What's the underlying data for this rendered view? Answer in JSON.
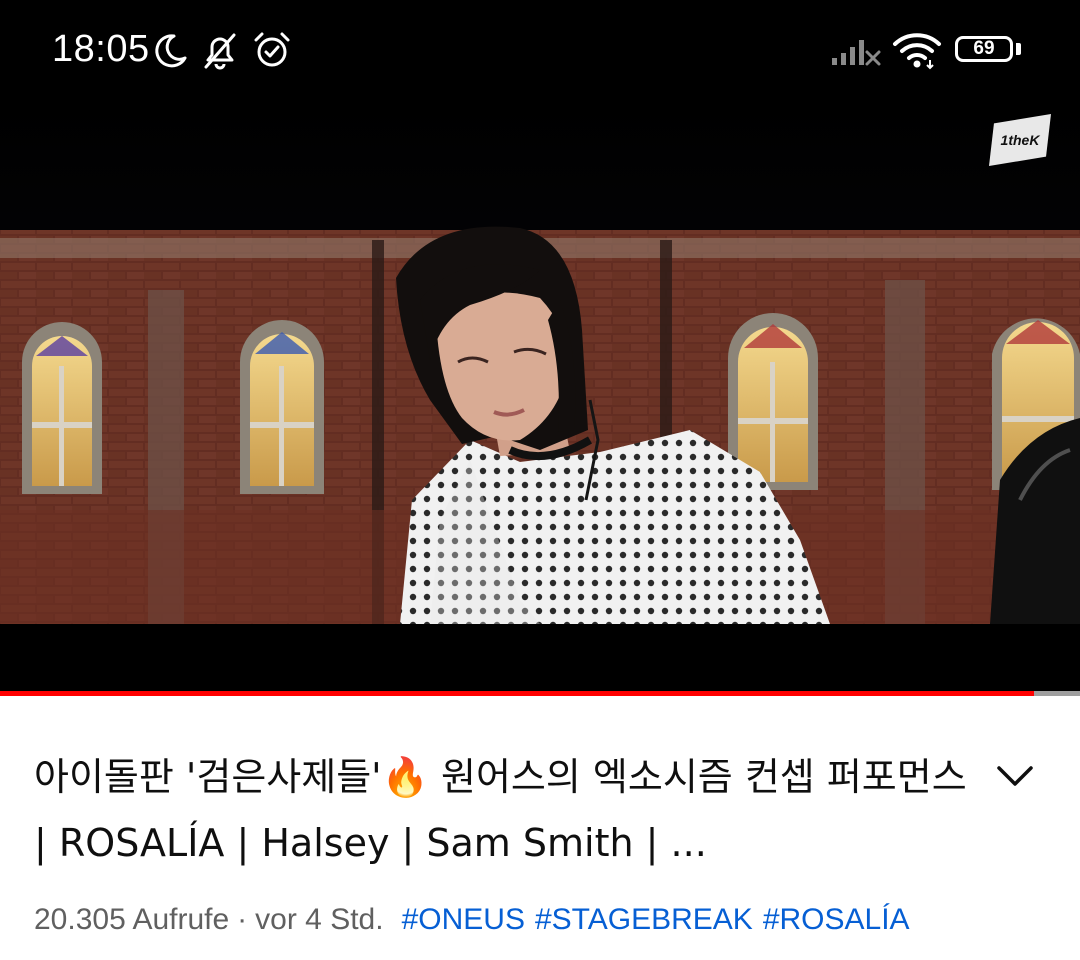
{
  "status_bar": {
    "time": "18:05",
    "battery_level": "69",
    "icons": [
      "moon-icon",
      "bell-off-icon",
      "alarm-clock-icon",
      "cellular-signal-off-icon",
      "wifi-icon",
      "battery-icon"
    ]
  },
  "video": {
    "watermark": "1theK",
    "progress_fraction": 0.957,
    "colors": {
      "progress_played": "#ff0000",
      "progress_track": "#9e9e9e",
      "background": "#000000"
    }
  },
  "video_info": {
    "title": "아이돌판 '검은사제들'🔥 원어스의 엑소시즘 컨셉 퍼포먼스 | ROSALÍA | Halsey | Sam Smith | ...",
    "expand_icon": "chevron-down-icon",
    "views": "20.305 Aufrufe",
    "separator": "·",
    "upload_time": "vor 4 Std.",
    "hashtags": [
      "#ONEUS",
      "#STAGEBREAK",
      "#ROSALÍA"
    ],
    "colors": {
      "title": "#0f0f0f",
      "meta": "#606060",
      "hashtag": "#065fd4"
    }
  }
}
